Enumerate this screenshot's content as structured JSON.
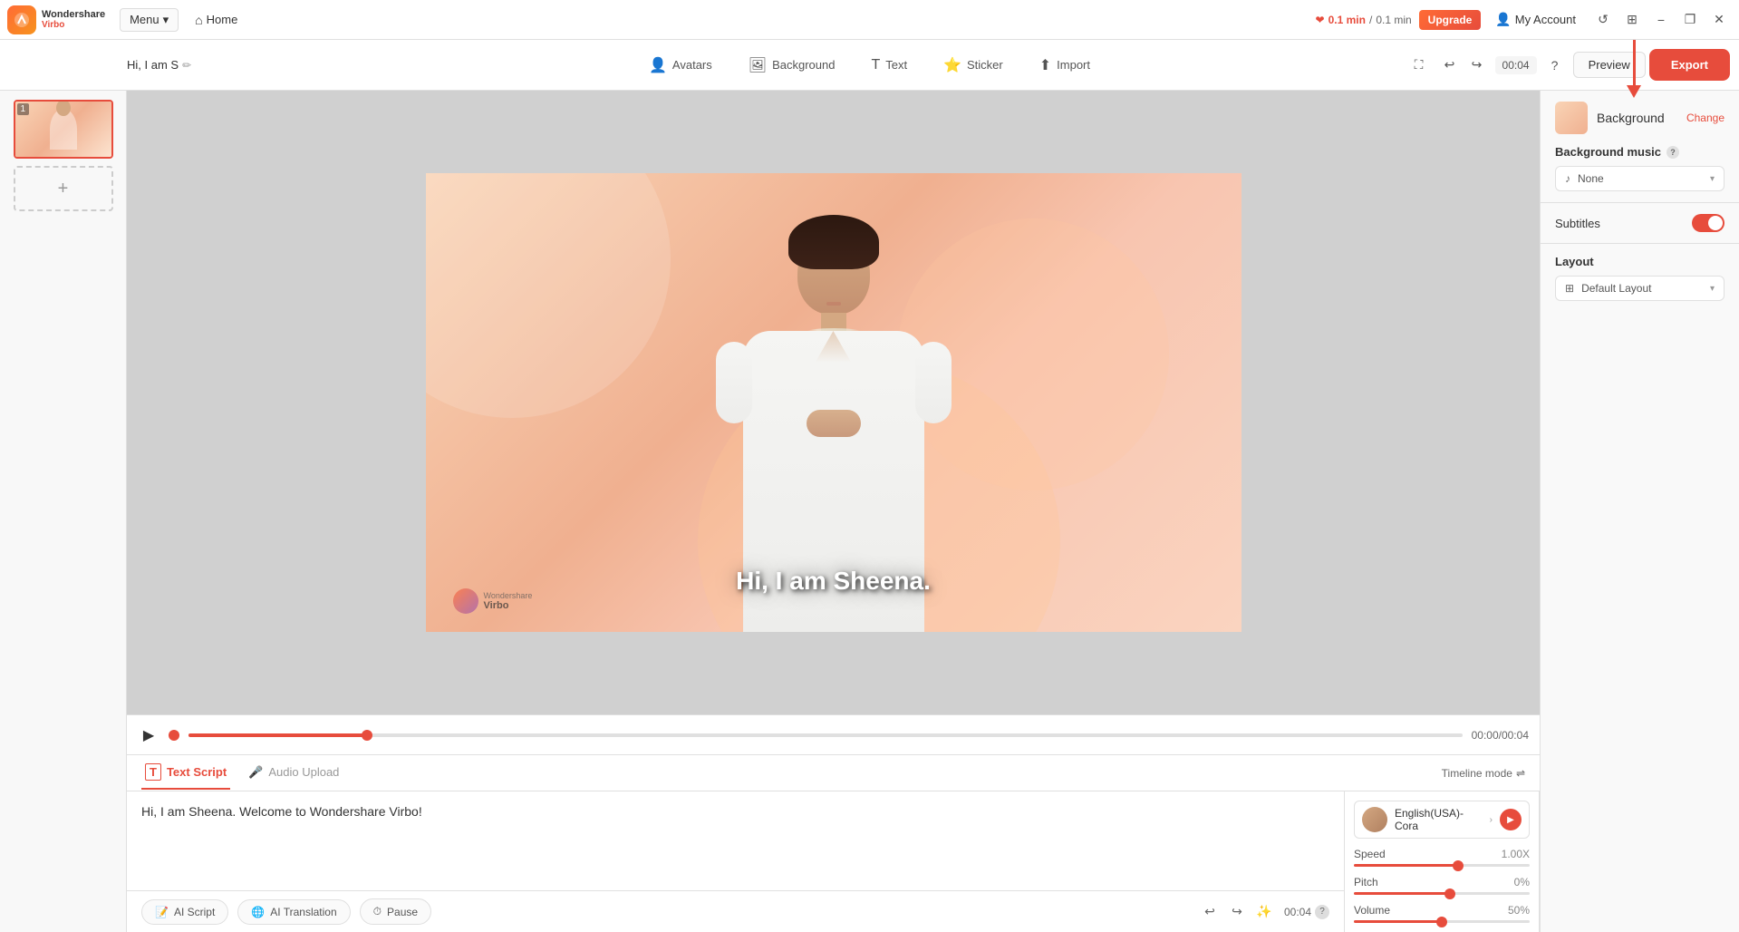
{
  "app": {
    "logo_name": "Wondershare",
    "logo_sub": "Virbo",
    "menu_label": "Menu",
    "home_label": "Home"
  },
  "topbar": {
    "time_used": "0.1 min",
    "time_total": "0.1 min",
    "upgrade_label": "Upgrade",
    "account_label": "My Account",
    "window_minimize": "−",
    "window_grid": "⊞",
    "window_restore": "❐",
    "window_close": "✕"
  },
  "toolbar": {
    "project_name": "Hi, I am S",
    "edit_icon": "✏",
    "avatars_label": "Avatars",
    "background_label": "Background",
    "text_label": "Text",
    "sticker_label": "Sticker",
    "import_label": "Import",
    "time_display": "00:04",
    "preview_label": "Preview",
    "export_label": "Export"
  },
  "slides": {
    "add_label": "+"
  },
  "canvas": {
    "subtitle": "Hi, I am Sheena.",
    "watermark_text": "Virbo"
  },
  "timeline": {
    "time_display": "00:00/00:04"
  },
  "script": {
    "text_script_label": "Text Script",
    "audio_upload_label": "Audio Upload",
    "timeline_mode_label": "Timeline mode",
    "script_content": "Hi, I am Sheena. Welcome to Wondershare Virbo!",
    "ai_script_label": "AI Script",
    "ai_translation_label": "AI Translation",
    "pause_label": "Pause",
    "duration": "00:04",
    "help_icon": "?"
  },
  "voice": {
    "name": "English(USA)-Cora",
    "speed_label": "Speed",
    "speed_value": "1.00X",
    "pitch_label": "Pitch",
    "pitch_value": "0%",
    "volume_label": "Volume",
    "volume_value": "50%"
  },
  "right_panel": {
    "bg_label": "Background",
    "change_label": "Change",
    "music_label": "Background music",
    "music_none": "None",
    "subtitles_label": "Subtitles",
    "layout_label": "Layout",
    "layout_default": "Default Layout"
  }
}
